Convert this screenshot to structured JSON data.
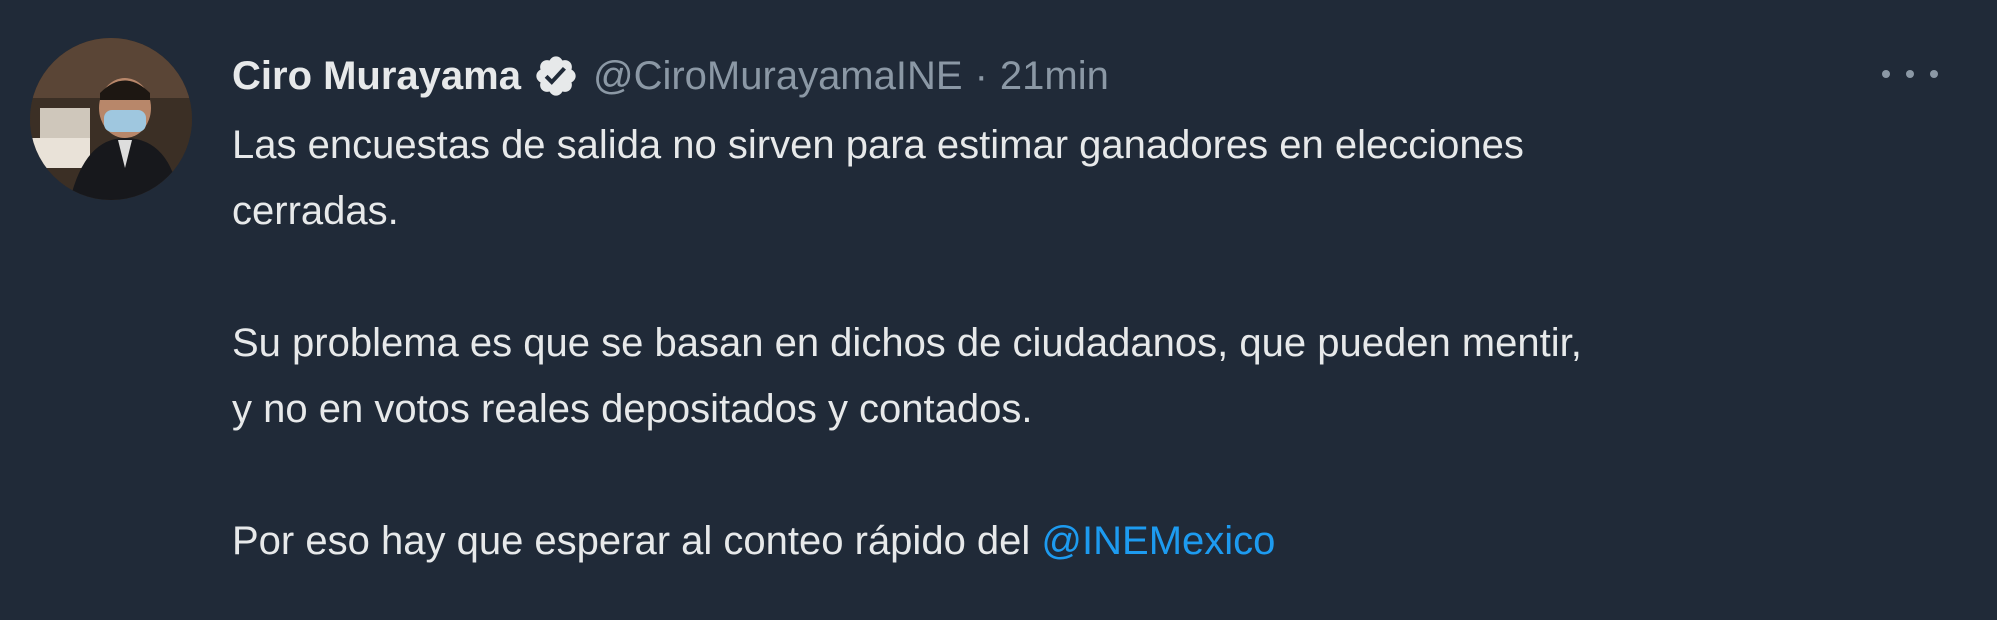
{
  "tweet": {
    "author": {
      "display_name": "Ciro Murayama",
      "handle": "@CiroMurayamaINE",
      "verified_icon": "verified-badge-icon",
      "avatar_icon": "profile-photo"
    },
    "separator": "·",
    "time": "21min",
    "more_icon": "more-options-icon",
    "paragraphs": {
      "p1_line1": "Las encuestas de salida no sirven para estimar ganadores en elecciones",
      "p1_line2": "cerradas.",
      "p2_line1": "Su problema es que se basan en dichos de ciudadanos, que pueden mentir,",
      "p2_line2": "y no en votos reales depositados y contados.",
      "p3_text": "Por eso hay que esperar al conteo rápido del ",
      "p3_mention": "@INEMexico"
    },
    "colors": {
      "background": "#202a38",
      "text": "#e7e9ea",
      "muted": "#8b98a5",
      "link": "#1d9bf0"
    }
  }
}
